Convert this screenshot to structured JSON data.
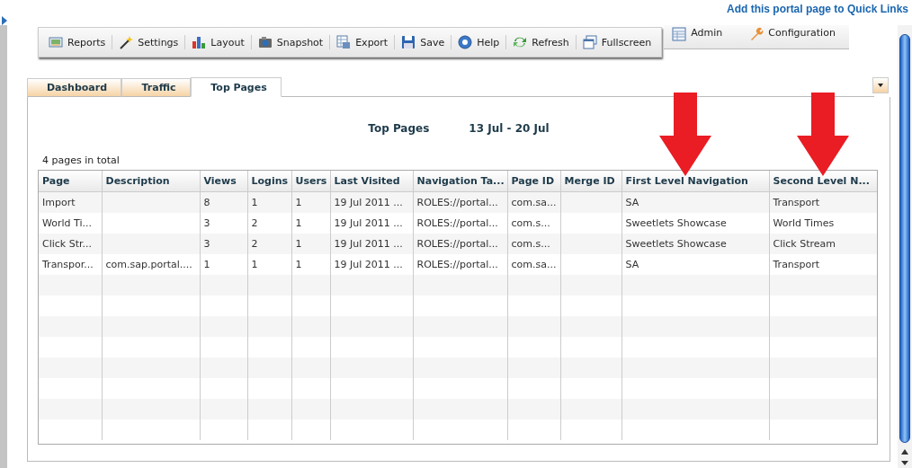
{
  "quick_link": "Add this portal page to Quick Links",
  "toolbar": [
    "Reports",
    "Settings",
    "Layout",
    "Snapshot",
    "Export",
    "Save",
    "Help",
    "Refresh",
    "Fullscreen"
  ],
  "admin_menu": [
    "Admin",
    "Configuration"
  ],
  "tabs": [
    {
      "label": "Dashboard",
      "selected": false
    },
    {
      "label": "Traffic",
      "selected": false
    },
    {
      "label": "Top Pages",
      "selected": true
    }
  ],
  "report": {
    "title": "Top Pages",
    "date_range": "13 Jul - 20 Jul",
    "total": "4 pages in total"
  },
  "table": {
    "columns": [
      "Page",
      "Description",
      "Views",
      "Logins",
      "Users",
      "Last Visited",
      "Navigation Ta...",
      "Page ID",
      "Merge ID",
      "First Level Navigation",
      "Second Level N..."
    ],
    "rows": [
      [
        "Import",
        null,
        "8",
        "1",
        "1",
        "19 Jul 2011 ...",
        "ROLES://portal...",
        "com.sa...",
        null,
        "SA",
        "Transport"
      ],
      [
        "World Ti...",
        null,
        "3",
        "2",
        "1",
        "19 Jul 2011 ...",
        "ROLES://portal...",
        "com.s...",
        null,
        "Sweetlets Showcase",
        "World Times"
      ],
      [
        "Click Str...",
        null,
        "3",
        "2",
        "1",
        "19 Jul 2011 ...",
        "ROLES://portal...",
        "com.s...",
        null,
        "Sweetlets Showcase",
        "Click Stream"
      ],
      [
        "Transpor...",
        "com.sap.portal....",
        "1",
        "1",
        "1",
        "19 Jul 2011 ...",
        "ROLES://portal...",
        "com.sa...",
        null,
        "SA",
        "Transport"
      ]
    ]
  }
}
